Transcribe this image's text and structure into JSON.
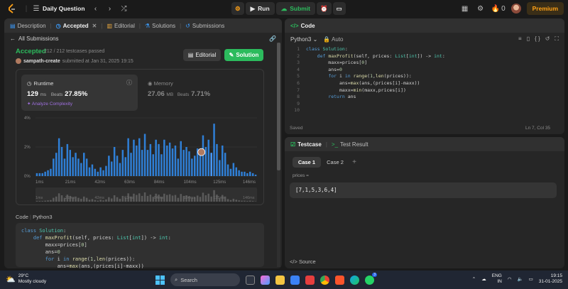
{
  "topbar": {
    "title": "Daily Question",
    "run_label": "Run",
    "submit_label": "Submit",
    "premium_label": "Premium",
    "streak_count": "0"
  },
  "left_panel": {
    "tabs": [
      {
        "label": "Description"
      },
      {
        "label": "Accepted"
      },
      {
        "label": "Editorial"
      },
      {
        "label": "Solutions"
      },
      {
        "label": "Submissions"
      }
    ],
    "all_submissions": "All Submissions",
    "status": "Accepted",
    "testcases": "212 / 212 testcases passed",
    "author": "sampath-create",
    "submitted_text": "submitted at Jan 31, 2025 19:15",
    "editorial_btn": "Editorial",
    "solution_btn": "Solution",
    "runtime": {
      "label": "Runtime",
      "value": "129",
      "unit": "ms",
      "beats_label": "Beats",
      "beats_value": "27.85%",
      "analyze": "Analyze Complexity"
    },
    "memory": {
      "label": "Memory",
      "value": "27.06",
      "unit": "MB",
      "beats_label": "Beats",
      "beats_value": "7.71%"
    },
    "code_label": "Code",
    "code_lang": "Python3",
    "code_lines": [
      "class Solution:",
      "    def maxProfit(self, prices: List[int]) -> int:",
      "        maxx=prices[0]",
      "        ans=0",
      "        for i in range(1,len(prices)):",
      "            ans=max(ans,(prices[i]-maxx))"
    ]
  },
  "chart_data": {
    "type": "bar",
    "y_ticks": [
      "4%",
      "2%",
      "0%"
    ],
    "ylim": [
      0,
      4
    ],
    "x_ticks": [
      "1ms",
      "21ms",
      "42ms",
      "63ms",
      "84ms",
      "104ms",
      "125ms",
      "146ms"
    ],
    "values": [
      0.2,
      0.2,
      0.2,
      0.3,
      0.4,
      0.5,
      1.2,
      1.6,
      2.6,
      2.0,
      1.2,
      2.2,
      1.8,
      1.3,
      1.6,
      1.2,
      0.9,
      1.6,
      1.2,
      0.6,
      0.8,
      0.5,
      0.3,
      0.6,
      0.4,
      0.7,
      1.4,
      1.0,
      2.0,
      1.4,
      0.9,
      1.8,
      1.3,
      2.6,
      1.6,
      2.5,
      2.1,
      2.6,
      1.8,
      2.9,
      1.8,
      2.2,
      1.5,
      2.5,
      2.2,
      1.5,
      2.5,
      2.1,
      2.3,
      1.9,
      2.1,
      1.2,
      2.4,
      1.8,
      2.0,
      1.7,
      1.2,
      1.4,
      1.9,
      1.5,
      2.8,
      2.0,
      2.5,
      1.6,
      3.6,
      2.2,
      1.1,
      2.1,
      1.6,
      0.8,
      0.5,
      0.9,
      0.6,
      0.4,
      0.3,
      0.3,
      0.2,
      0.3,
      0.2,
      0.1
    ],
    "highlight_index": 63
  },
  "right_panel": {
    "code_tab": "Code",
    "lang": "Python3",
    "auto_label": "Auto",
    "editor_lines": [
      "class Solution:",
      "    def maxProfit(self, prices: List[int]) -> int:",
      "        maxx=prices[0]",
      "        ans=0",
      "        for i in range(1,len(prices)):",
      "            ans=max(ans,(prices[i]-maxx))",
      "            maxx=min(maxx,prices[i])",
      "        return ans",
      "",
      ""
    ],
    "line_numbers": [
      "1",
      "2",
      "3",
      "4",
      "5",
      "6",
      "7",
      "8",
      "9",
      "10"
    ],
    "saved": "Saved",
    "cursor": "Ln 7, Col 35",
    "testcase_tab": "Testcase",
    "result_tab": "Test Result",
    "case1": "Case 1",
    "case2": "Case 2",
    "add_case": "+",
    "input_label": "prices =",
    "input_value": "[7,1,5,3,6,4]",
    "source_label": "Source"
  },
  "taskbar": {
    "temp": "29°C",
    "weather": "Mostly cloudy",
    "search": "Search",
    "lang_line1": "ENG",
    "lang_line2": "IN",
    "time": "19:15",
    "date": "31-01-2025",
    "notif_badge": "3"
  }
}
